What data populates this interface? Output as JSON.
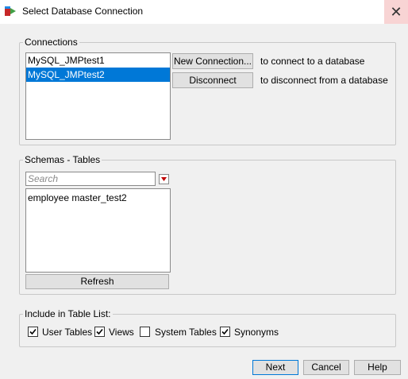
{
  "window": {
    "title": "Select Database Connection",
    "close_glyph": "✕"
  },
  "connections": {
    "legend": "Connections",
    "items": [
      {
        "label": "MySQL_JMPtest1",
        "selected": false
      },
      {
        "label": "MySQL_JMPtest2",
        "selected": true
      }
    ],
    "new_button": "New Connection...",
    "new_hint": "to connect to a database",
    "disconnect_button": "Disconnect",
    "disconnect_hint": "to disconnect from a database"
  },
  "schemas": {
    "legend": "Schemas - Tables",
    "search_placeholder": "Search",
    "items": [
      {
        "label": "employee master_test2"
      }
    ],
    "refresh_button": "Refresh"
  },
  "include": {
    "legend": "Include in Table List:",
    "options": [
      {
        "label": "User Tables",
        "checked": true
      },
      {
        "label": "Views",
        "checked": true
      },
      {
        "label": "System Tables",
        "checked": false
      },
      {
        "label": "Synonyms",
        "checked": true
      }
    ]
  },
  "footer": {
    "next_button": "Next",
    "cancel_button": "Cancel",
    "help_button": "Help"
  },
  "colors": {
    "selection": "#0078d7",
    "close_hover": "#f8d4d4",
    "dropdown_arrow": "#c00000"
  }
}
